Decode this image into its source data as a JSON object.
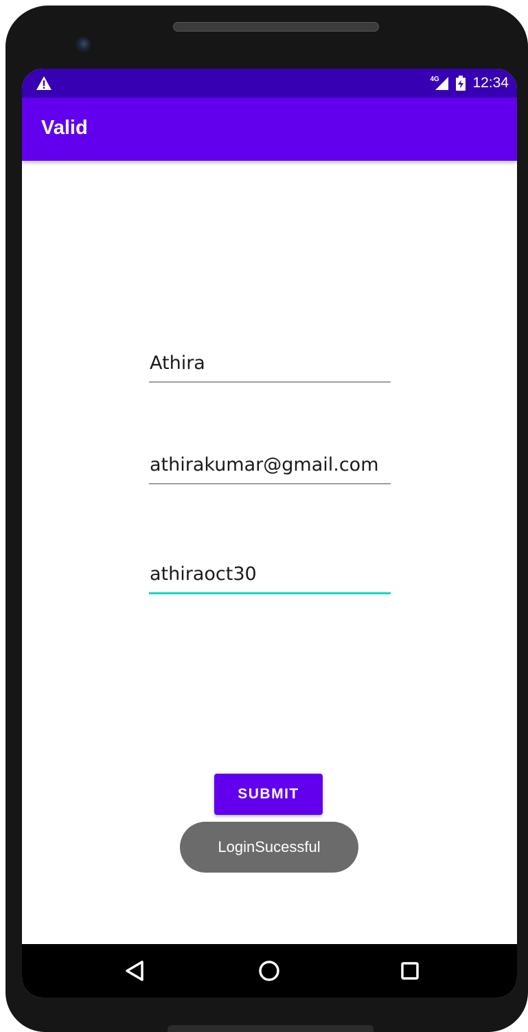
{
  "status_bar": {
    "network_label": "4G",
    "time": "12:34"
  },
  "app_bar": {
    "title": "Valid"
  },
  "form": {
    "name_value": "Athira",
    "email_value": "athirakumar@gmail.com",
    "password_value": "athiraoct30",
    "submit_label": "SUBMIT"
  },
  "toast": {
    "message": "LoginSucessful"
  },
  "colors": {
    "status_bar": "#3700b3",
    "primary": "#6200ee",
    "accent": "#03dac5",
    "toast": "#6b6b6b"
  },
  "icons": {
    "status_left": "warning-icon",
    "status_right": [
      "signal-icon",
      "battery-icon"
    ],
    "navigation": [
      "back-icon",
      "home-icon",
      "recents-icon"
    ]
  }
}
